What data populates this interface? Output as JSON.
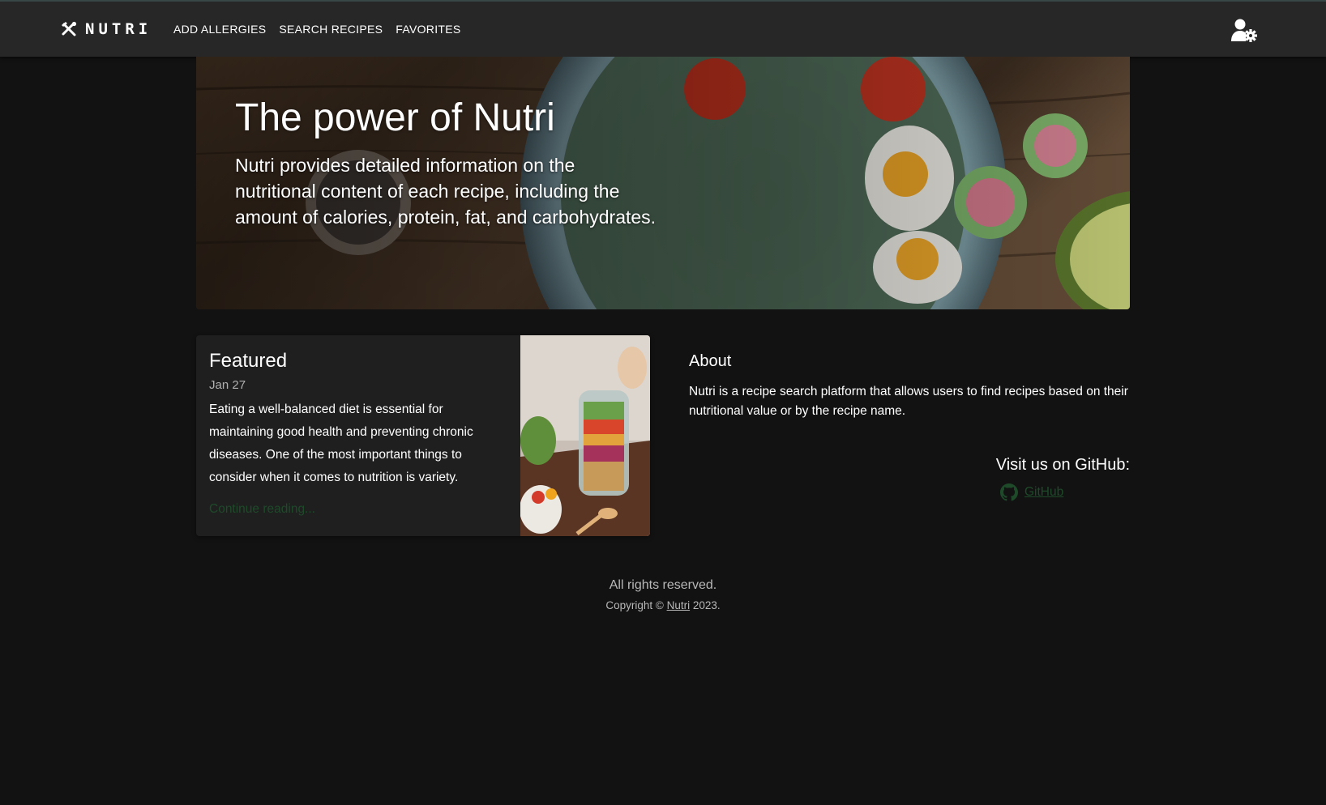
{
  "brand": {
    "name": "NUTRI",
    "logo_icon": "fork-knife-crossed-icon"
  },
  "nav": {
    "links": [
      {
        "label": "ADD ALLERGIES"
      },
      {
        "label": "SEARCH RECIPES"
      },
      {
        "label": "FAVORITES"
      }
    ],
    "user_icon": "user-settings-icon"
  },
  "hero": {
    "title": "The power of Nutri",
    "body": "Nutri provides detailed information on the nutritional content of each recipe, including the amount of calories, protein, fat, and carbohydrates."
  },
  "featured": {
    "title": "Featured",
    "date": "Jan 27",
    "body": "Eating a well-balanced diet is essential for maintaining good health and preventing chronic diseases. One of the most important things to consider when it comes to nutrition is variety.",
    "link_label": "Continue reading..."
  },
  "about": {
    "title": "About",
    "body": "Nutri is a recipe search platform that allows users to find recipes based on their nutritional value or by the recipe name."
  },
  "github": {
    "heading": "Visit us on GitHub:",
    "link_label": "GitHub",
    "icon": "github-icon"
  },
  "footer": {
    "rights": "All rights reserved.",
    "copyright_prefix": "Copyright ©",
    "copyright_link": "Nutri",
    "copyright_year": "2023."
  },
  "colors": {
    "page_bg": "#121212",
    "navbar_bg": "#272727",
    "card_bg": "#1f1f1f",
    "link_green": "#1e4a2a"
  }
}
